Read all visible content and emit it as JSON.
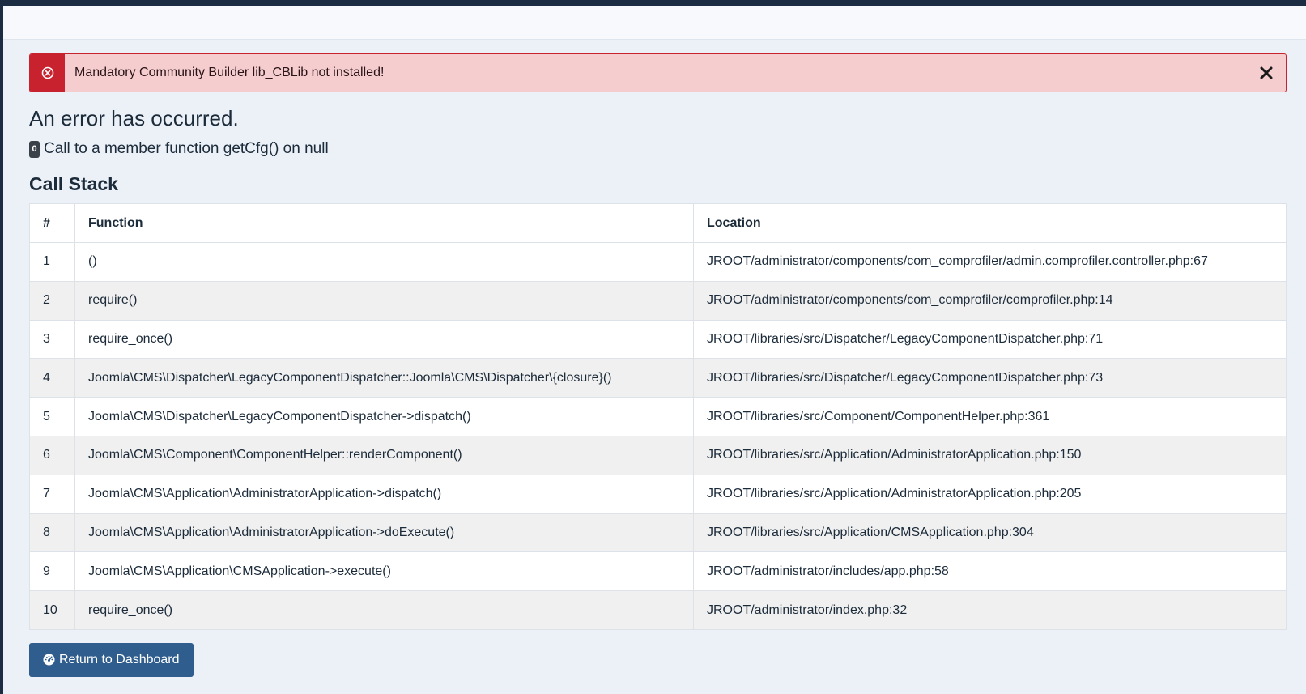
{
  "alert": {
    "message": "Mandatory Community Builder lib_CBLib not installed!",
    "icon": "error-circle-icon",
    "close_icon": "close-icon",
    "color": "#c8222e"
  },
  "error": {
    "title": "An error has occurred.",
    "code": "0",
    "message": "Call to a member function getCfg() on null"
  },
  "call_stack": {
    "title": "Call Stack",
    "columns": [
      "#",
      "Function",
      "Location"
    ],
    "rows": [
      {
        "num": "1",
        "function": "()",
        "location": "JROOT/administrator/components/com_comprofiler/admin.comprofiler.controller.php:67"
      },
      {
        "num": "2",
        "function": "require()",
        "location": "JROOT/administrator/components/com_comprofiler/comprofiler.php:14"
      },
      {
        "num": "3",
        "function": "require_once()",
        "location": "JROOT/libraries/src/Dispatcher/LegacyComponentDispatcher.php:71"
      },
      {
        "num": "4",
        "function": "Joomla\\CMS\\Dispatcher\\LegacyComponentDispatcher::Joomla\\CMS\\Dispatcher\\{closure}()",
        "location": "JROOT/libraries/src/Dispatcher/LegacyComponentDispatcher.php:73"
      },
      {
        "num": "5",
        "function": "Joomla\\CMS\\Dispatcher\\LegacyComponentDispatcher->dispatch()",
        "location": "JROOT/libraries/src/Component/ComponentHelper.php:361"
      },
      {
        "num": "6",
        "function": "Joomla\\CMS\\Component\\ComponentHelper::renderComponent()",
        "location": "JROOT/libraries/src/Application/AdministratorApplication.php:150"
      },
      {
        "num": "7",
        "function": "Joomla\\CMS\\Application\\AdministratorApplication->dispatch()",
        "location": "JROOT/libraries/src/Application/AdministratorApplication.php:205"
      },
      {
        "num": "8",
        "function": "Joomla\\CMS\\Application\\AdministratorApplication->doExecute()",
        "location": "JROOT/libraries/src/Application/CMSApplication.php:304"
      },
      {
        "num": "9",
        "function": "Joomla\\CMS\\Application\\CMSApplication->execute()",
        "location": "JROOT/administrator/includes/app.php:58"
      },
      {
        "num": "10",
        "function": "require_once()",
        "location": "JROOT/administrator/index.php:32"
      }
    ]
  },
  "actions": {
    "return_label": "Return to Dashboard",
    "return_icon": "dashboard-gauge-icon",
    "button_color": "#2f5d8e"
  }
}
